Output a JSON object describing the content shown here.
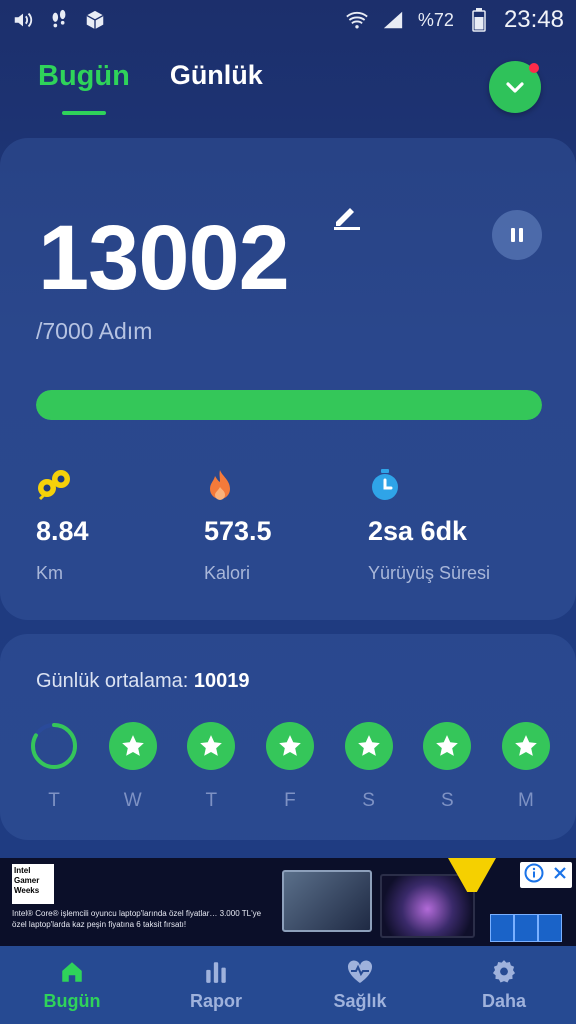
{
  "status_bar": {
    "battery": "%72",
    "time": "23:48",
    "icons": [
      "volume-icon",
      "footsteps-icon",
      "box-icon",
      "wifi-icon",
      "signal-icon",
      "battery-icon"
    ]
  },
  "header": {
    "tabs": [
      {
        "label": "Bugün",
        "active": true
      },
      {
        "label": "Günlük",
        "active": false
      }
    ]
  },
  "today": {
    "steps": "13002",
    "goal": "/7000 Adım",
    "progress_fraction": 1.0,
    "stats": [
      {
        "icon": "distance-icon",
        "value": "8.84",
        "label": "Km"
      },
      {
        "icon": "flame-icon",
        "value": "573.5",
        "label": "Kalori"
      },
      {
        "icon": "stopwatch-icon",
        "value": "2sa 6dk",
        "label": "Yürüyüş Süresi"
      }
    ]
  },
  "weekly": {
    "avg_label": "Günlük ortalama:",
    "avg_value": "10019",
    "days": [
      {
        "label": "T",
        "complete": false
      },
      {
        "label": "W",
        "complete": true
      },
      {
        "label": "T",
        "complete": true
      },
      {
        "label": "F",
        "complete": true
      },
      {
        "label": "S",
        "complete": true
      },
      {
        "label": "S",
        "complete": true
      },
      {
        "label": "M",
        "complete": true
      }
    ]
  },
  "ad": {
    "logo_text": "Intel Gamer Weeks",
    "text": "Intel® Core® işlemcili oyuncu laptop'larında özel fiyatlar… 3.000 TL'ye özel laptop'larda kaz peşin fiyatına 6 taksit fırsatı!"
  },
  "bottom_nav": [
    {
      "label": "Bugün",
      "icon": "home-icon",
      "active": true
    },
    {
      "label": "Rapor",
      "icon": "bar-chart-icon",
      "active": false
    },
    {
      "label": "Sağlık",
      "icon": "heart-pulse-icon",
      "active": false
    },
    {
      "label": "Daha",
      "icon": "gear-icon",
      "active": false
    }
  ],
  "colors": {
    "accent": "#2fd35a",
    "background": "#1f3a7e",
    "progress": "#34c759"
  }
}
